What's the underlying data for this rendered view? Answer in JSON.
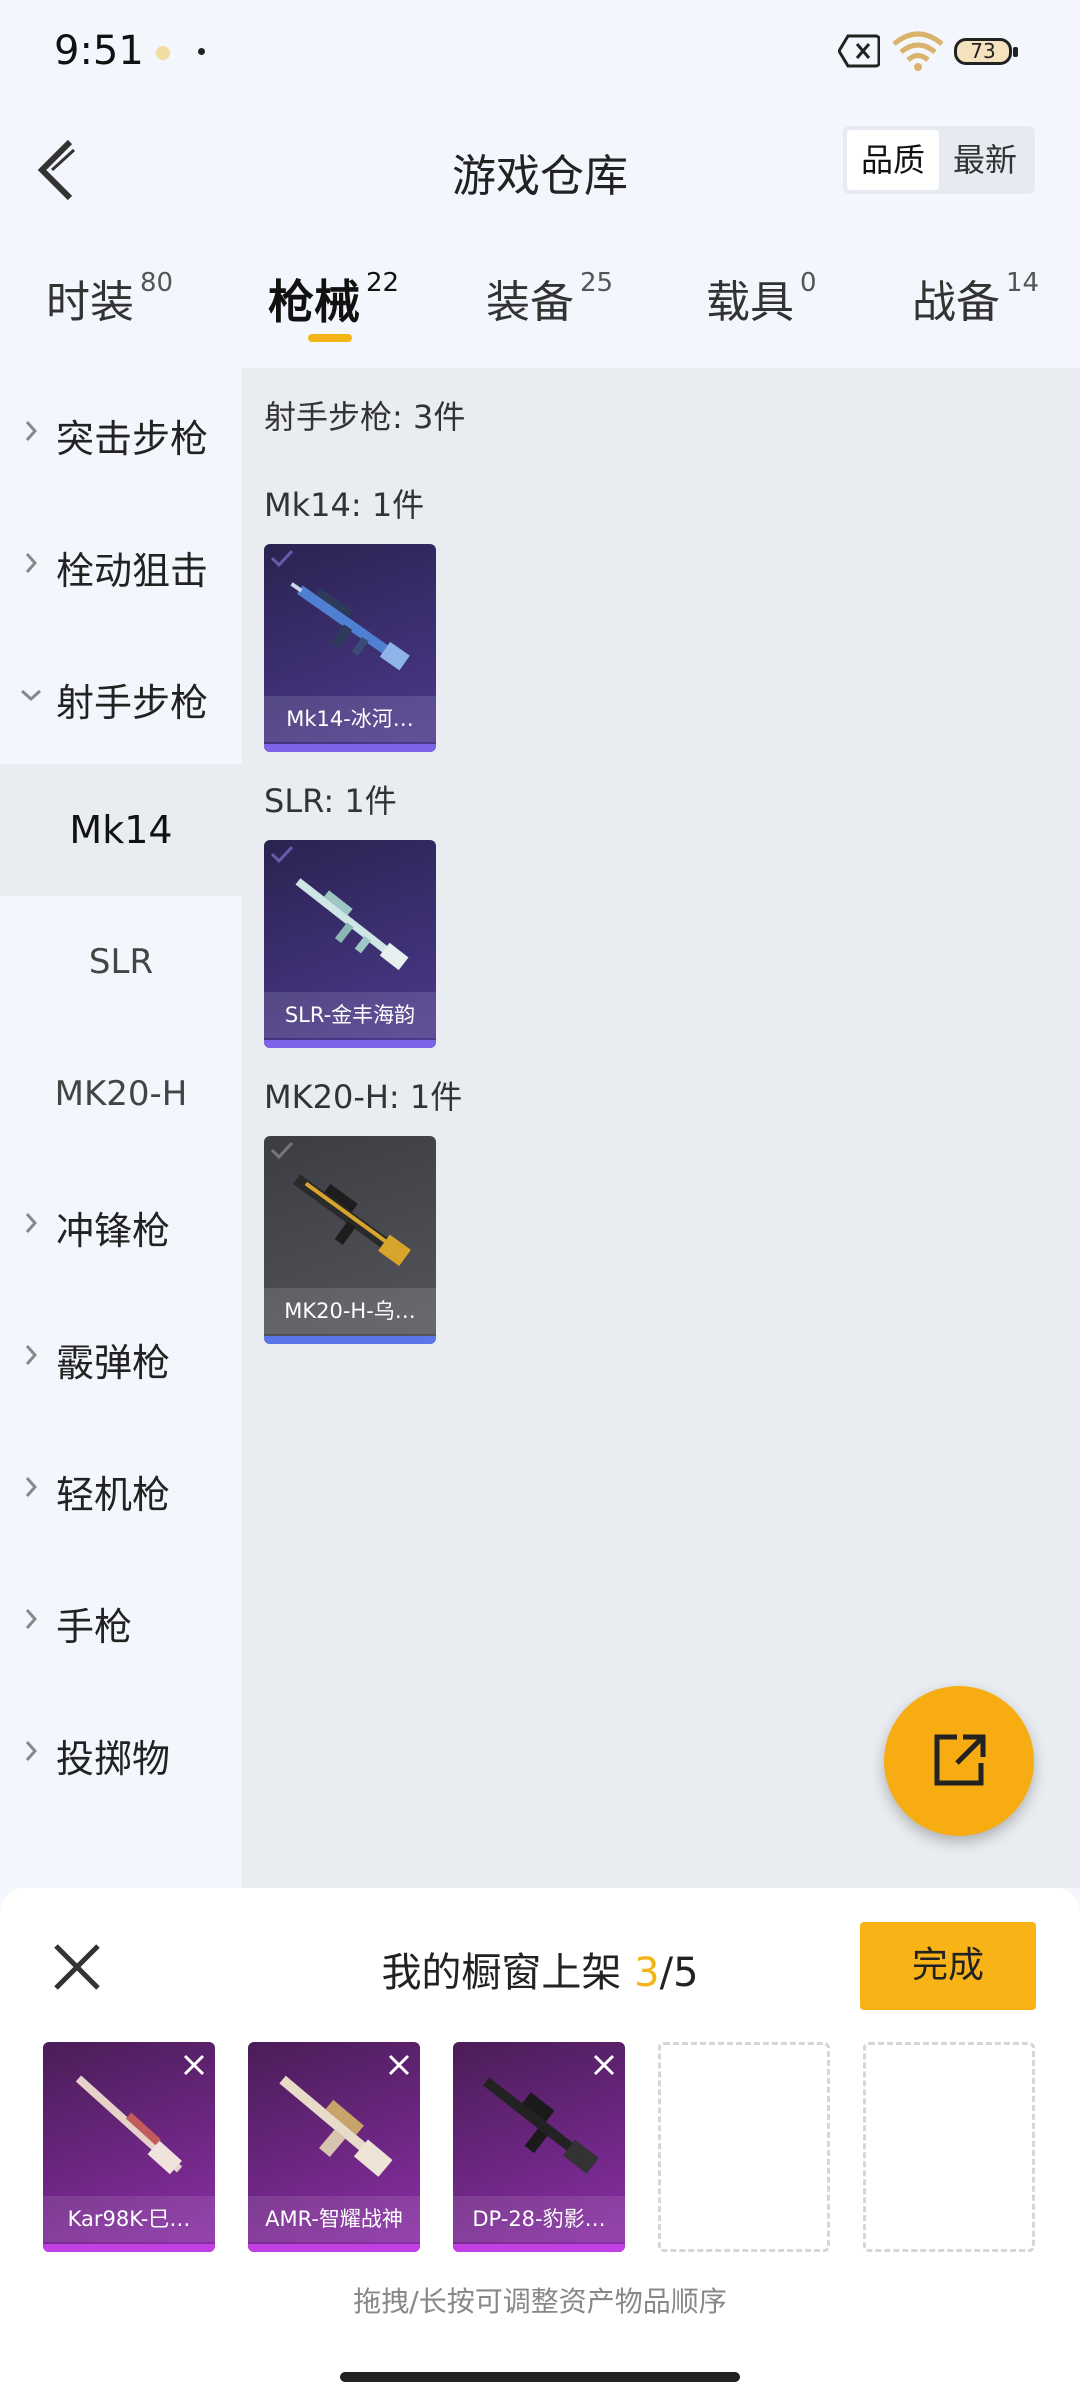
{
  "status_bar": {
    "time": "9:51",
    "battery": "73"
  },
  "header": {
    "title": "游戏仓库",
    "sort_options": [
      "品质",
      "最新"
    ],
    "active_sort": "品质"
  },
  "tabs": [
    {
      "label": "时装",
      "count": "80"
    },
    {
      "label": "枪械",
      "count": "22",
      "active": true
    },
    {
      "label": "装备",
      "count": "25"
    },
    {
      "label": "载具",
      "count": "0"
    },
    {
      "label": "战备",
      "count": "14"
    }
  ],
  "sidebar": {
    "categories": [
      {
        "label": "突击步枪",
        "expanded": false
      },
      {
        "label": "栓动狙击",
        "expanded": false
      },
      {
        "label": "射手步枪",
        "expanded": true
      },
      {
        "label": "冲锋枪",
        "expanded": false
      },
      {
        "label": "霰弹枪",
        "expanded": false
      },
      {
        "label": "轻机枪",
        "expanded": false
      },
      {
        "label": "手枪",
        "expanded": false
      },
      {
        "label": "投掷物",
        "expanded": false
      }
    ],
    "subitems": [
      {
        "label": "Mk14",
        "active": true
      },
      {
        "label": "SLR",
        "active": false
      },
      {
        "label": "MK20-H",
        "active": false
      }
    ]
  },
  "main": {
    "summary": "射手步枪: 3件",
    "groups": [
      {
        "title": "Mk14: 1件",
        "item": {
          "name": "Mk14-冰河…",
          "bg": "#3b2d6e",
          "bar": "#7d63e8"
        }
      },
      {
        "title": "SLR: 1件",
        "item": {
          "name": "SLR-金丰海韵",
          "bg": "#3b2d6e",
          "bar": "#7d63e8"
        }
      },
      {
        "title": "MK20-H: 1件",
        "item": {
          "name": "MK20-H-乌…",
          "bg": "#47484d",
          "bar": "#5a76e8"
        }
      }
    ]
  },
  "showcase": {
    "title_prefix": "我的橱窗上架 ",
    "count": "3",
    "total": "/5",
    "done_label": "完成",
    "slots": [
      {
        "name": "Kar98K-巳…"
      },
      {
        "name": "AMR-智耀战神"
      },
      {
        "name": "DP-28-豹影…"
      }
    ],
    "hint": "拖拽/长按可调整资产物品顺序"
  },
  "colors": {
    "accent": "#f5b415",
    "panel": "#e9ecf0",
    "legendary": "#c23fe3"
  }
}
